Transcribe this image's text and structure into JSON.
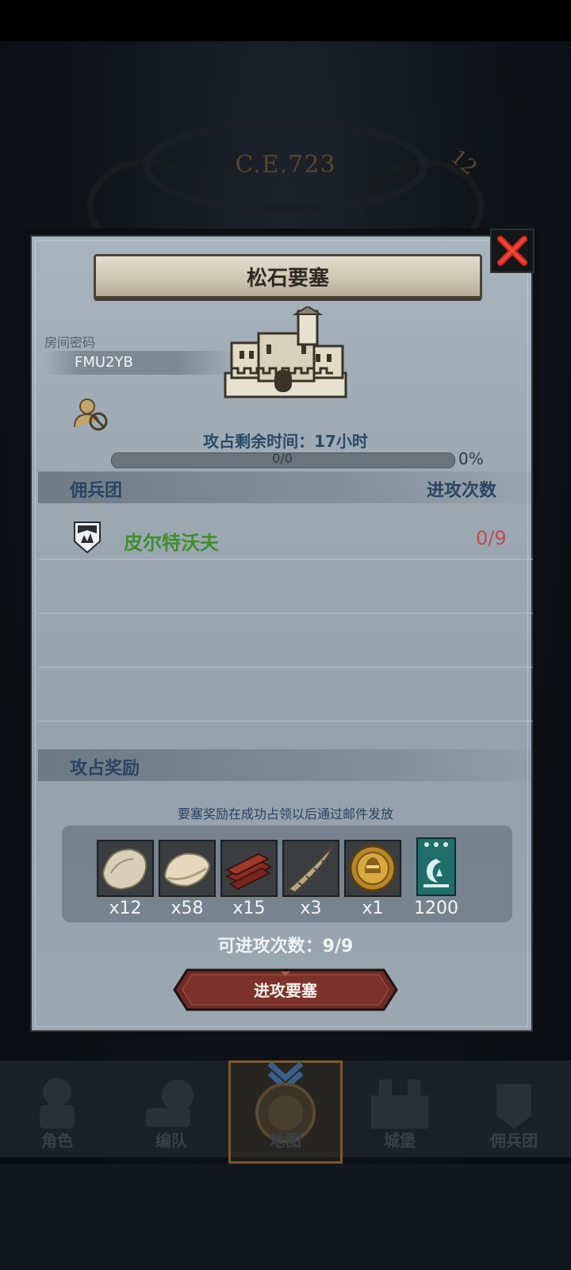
{
  "header": {
    "era": "C.E.723",
    "day": "12"
  },
  "panel": {
    "title": "松石要塞",
    "room_label": "房间密码",
    "room_code": "FMU2YB",
    "time_label": "攻占剩余时间：",
    "time_value": "17小时",
    "progress_text": "0/0",
    "progress_percent": "0%",
    "progress_fraction": 0,
    "mercenary_header": "佣兵团",
    "attack_count_header": "进攻次数",
    "mercenary": {
      "name": "皮尔特沃夫",
      "attacks": "0/9"
    },
    "rewards_header": "攻占奖励",
    "reward_note": "要塞奖励在成功占领以后通过邮件发放",
    "rewards": [
      {
        "icon": "pelt-icon",
        "count": "x12"
      },
      {
        "icon": "hide-icon",
        "count": "x58"
      },
      {
        "icon": "lumber-icon",
        "count": "x15"
      },
      {
        "icon": "horn-icon",
        "count": "x3"
      },
      {
        "icon": "gold-medal-icon",
        "count": "x1"
      },
      {
        "icon": "banner-icon",
        "count": "1200"
      }
    ],
    "attacks_left_label": "可进攻次数：",
    "attacks_left_value": "9/9",
    "attack_button": "进攻要塞"
  },
  "nav": [
    {
      "label": "角色",
      "icon": "character-icon"
    },
    {
      "label": "编队",
      "icon": "formation-icon"
    },
    {
      "label": "地图",
      "icon": "map-icon",
      "selected": true
    },
    {
      "label": "城堡",
      "icon": "castle-icon"
    },
    {
      "label": "佣兵团",
      "icon": "mercenary-icon"
    }
  ],
  "colors": {
    "mercenary_name": "#3f8e2a",
    "attack_count": "#c44a4a",
    "button": "#6e2a24"
  }
}
